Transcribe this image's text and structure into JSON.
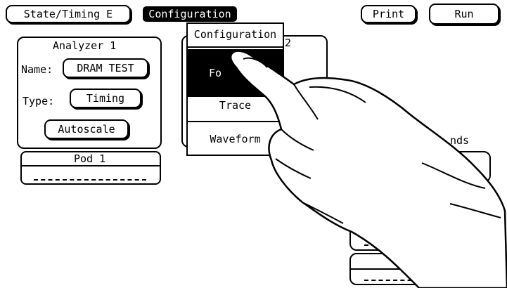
{
  "toolbar": {
    "mode_label": "State/Timing E",
    "config_label": "Configuration",
    "print_label": "Print",
    "run_label": "Run"
  },
  "analyzer": {
    "title": "Analyzer 1",
    "name_label": "Name:",
    "name_value": "DRAM TEST",
    "type_label": "Type:",
    "type_value": "Timing",
    "autoscale_label": "Autoscale"
  },
  "pod": {
    "label": "Pod 1"
  },
  "menu": {
    "items": [
      {
        "label": "Configuration"
      },
      {
        "label": "Fo"
      },
      {
        "label": "Trace"
      },
      {
        "label": "Waveform"
      }
    ]
  },
  "background_fragments": {
    "digit": "2",
    "right_text": "nds"
  }
}
